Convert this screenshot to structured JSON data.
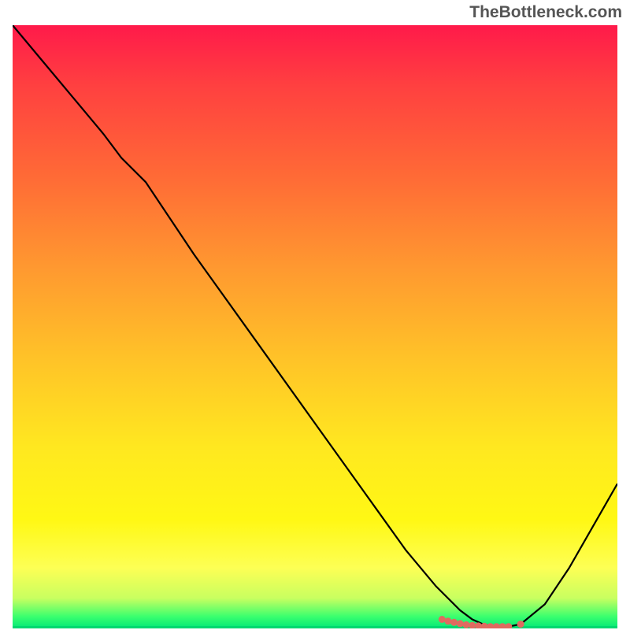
{
  "watermark": "TheBottleneck.com",
  "chart_data": {
    "type": "line",
    "title": "",
    "xlabel": "",
    "ylabel": "",
    "xlim": [
      0,
      100
    ],
    "ylim": [
      0,
      100
    ],
    "series": [
      {
        "name": "curve",
        "x": [
          0,
          5,
          10,
          15,
          18,
          22,
          30,
          40,
          50,
          60,
          65,
          70,
          74,
          76,
          78,
          80,
          82,
          84,
          88,
          92,
          96,
          100
        ],
        "y": [
          100,
          94,
          88,
          82,
          78,
          74,
          62,
          48,
          34,
          20,
          13,
          7,
          3,
          1.5,
          0.6,
          0.3,
          0.3,
          0.7,
          4,
          10,
          17,
          24
        ]
      }
    ],
    "markers": {
      "name": "bottom-dots",
      "x": [
        71,
        72,
        73,
        74,
        75,
        76,
        77,
        78,
        79,
        80,
        81,
        82,
        84
      ],
      "y": [
        1.5,
        1.2,
        1.0,
        0.8,
        0.6,
        0.5,
        0.4,
        0.35,
        0.3,
        0.3,
        0.3,
        0.3,
        0.7
      ],
      "color": "#e06a60"
    },
    "gradient_stops": [
      {
        "pos": 0,
        "color": "#ff1a4a"
      },
      {
        "pos": 50,
        "color": "#ffc228"
      },
      {
        "pos": 90,
        "color": "#fdff55"
      },
      {
        "pos": 100,
        "color": "#00e878"
      }
    ]
  }
}
